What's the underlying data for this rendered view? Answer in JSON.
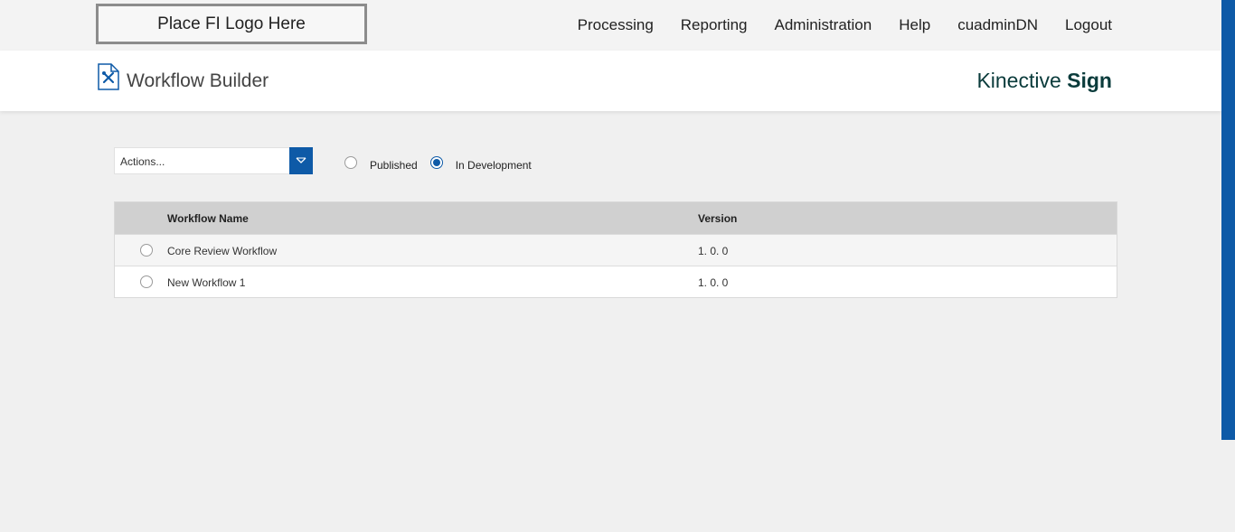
{
  "header": {
    "logo_text": "Place FI Logo Here",
    "nav": [
      "Processing",
      "Reporting",
      "Administration",
      "Help",
      "cuadminDN",
      "Logout"
    ]
  },
  "titlebar": {
    "title": "Workflow Builder",
    "brand_light": "Kinective",
    "brand_bold": "Sign",
    "icon": "workflow-tools-icon"
  },
  "toolbar": {
    "actions_value": "Actions...",
    "filter_options": [
      {
        "label": "Published",
        "checked": false
      },
      {
        "label": "In Development",
        "checked": true
      }
    ]
  },
  "table": {
    "columns": [
      "Workflow Name",
      "Version"
    ],
    "rows": [
      {
        "name": "Core Review Workflow",
        "version": "1. 0. 0"
      },
      {
        "name": "New Workflow 1",
        "version": "1. 0. 0"
      }
    ]
  },
  "colors": {
    "accent": "#0e5aa7",
    "brand_text": "#0a3b3b",
    "header_bg": "#f3f3f3",
    "grid_header_bg": "#d0d0d0"
  }
}
